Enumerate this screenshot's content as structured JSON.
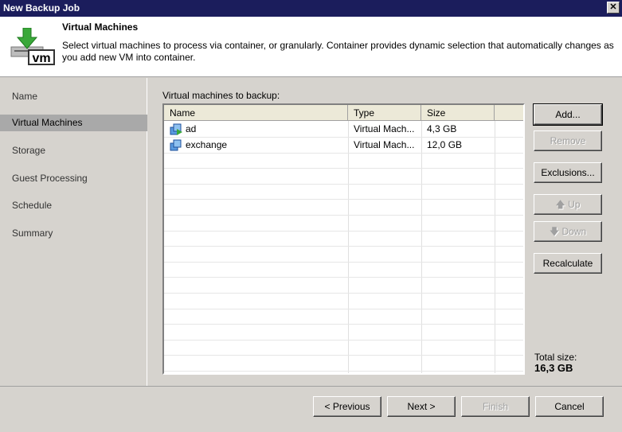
{
  "window": {
    "title": "New Backup Job",
    "close": "✕"
  },
  "header": {
    "title": "Virtual Machines",
    "description": "Select virtual machines to process via container, or granularly. Container provides dynamic selection that automatically changes as you add new VM into container.",
    "icon": "vm-download-icon"
  },
  "sidebar": {
    "items": [
      {
        "label": "Name"
      },
      {
        "label": "Virtual Machines",
        "selected": true
      },
      {
        "label": "Storage"
      },
      {
        "label": "Guest Processing"
      },
      {
        "label": "Schedule"
      },
      {
        "label": "Summary"
      }
    ]
  },
  "main": {
    "list_label": "Virtual machines to backup:",
    "columns": [
      "Name",
      "Type",
      "Size"
    ],
    "rows": [
      {
        "name": "ad",
        "type": "Virtual Mach...",
        "size": "4,3 GB"
      },
      {
        "name": "exchange",
        "type": "Virtual Mach...",
        "size": "12,0 GB"
      }
    ],
    "buttons": {
      "add": "Add...",
      "remove": "Remove",
      "exclusions": "Exclusions...",
      "up": "Up",
      "down": "Down",
      "recalculate": "Recalculate"
    },
    "total_label": "Total size:",
    "total_value": "16,3 GB"
  },
  "footer": {
    "previous": "< Previous",
    "next": "Next >",
    "finish": "Finish",
    "cancel": "Cancel"
  }
}
